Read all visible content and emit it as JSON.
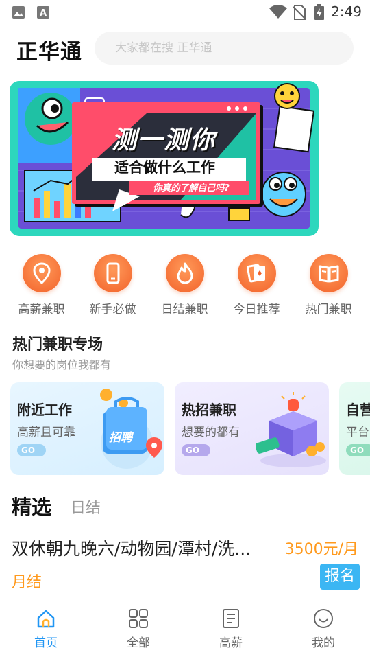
{
  "status_bar": {
    "time": "2:49",
    "icons": [
      "image-icon",
      "a-icon",
      "wifi-icon",
      "no-sim-icon",
      "battery-charging-icon"
    ]
  },
  "header": {
    "logo": "正华通",
    "search_placeholder": "大家都在搜 正华通"
  },
  "banner": {
    "title": "测一测你",
    "subtitle": "适合做什么工作",
    "tagline": "你真的了解自己吗?"
  },
  "quick_links": [
    {
      "label": "高薪兼职",
      "icon": "location-pin-icon"
    },
    {
      "label": "新手必做",
      "icon": "phone-icon"
    },
    {
      "label": "日结兼职",
      "icon": "fire-icon"
    },
    {
      "label": "今日推荐",
      "icon": "cards-icon"
    },
    {
      "label": "热门兼职",
      "icon": "book-icon"
    }
  ],
  "section": {
    "title": "热门兼职专场",
    "subtitle": "你想要的岗位我都有"
  },
  "cards": [
    {
      "title": "附近工作",
      "subtitle": "高薪且可靠",
      "go": "GO",
      "badge": "招聘"
    },
    {
      "title": "热招兼职",
      "subtitle": "想要的都有",
      "go": "GO"
    },
    {
      "title": "自营",
      "subtitle": "平台",
      "go": "GO"
    }
  ],
  "tabs": {
    "active": "精选",
    "other": "日结"
  },
  "job": {
    "title": "双休朝九晚六/动物园/潭村/洗...",
    "salary": "3500元/月",
    "tag": "月结",
    "apply": "报名"
  },
  "bottom_nav": [
    {
      "label": "首页",
      "icon": "home-icon",
      "active": true
    },
    {
      "label": "全部",
      "icon": "grid-icon",
      "active": false
    },
    {
      "label": "高薪",
      "icon": "document-icon",
      "active": false
    },
    {
      "label": "我的",
      "icon": "smiley-icon",
      "active": false
    }
  ],
  "colors": {
    "accent": "#2196f3",
    "orange": "#ff9a1e",
    "apply": "#3bb6f3",
    "banner_bg": "#2dd7bd"
  }
}
